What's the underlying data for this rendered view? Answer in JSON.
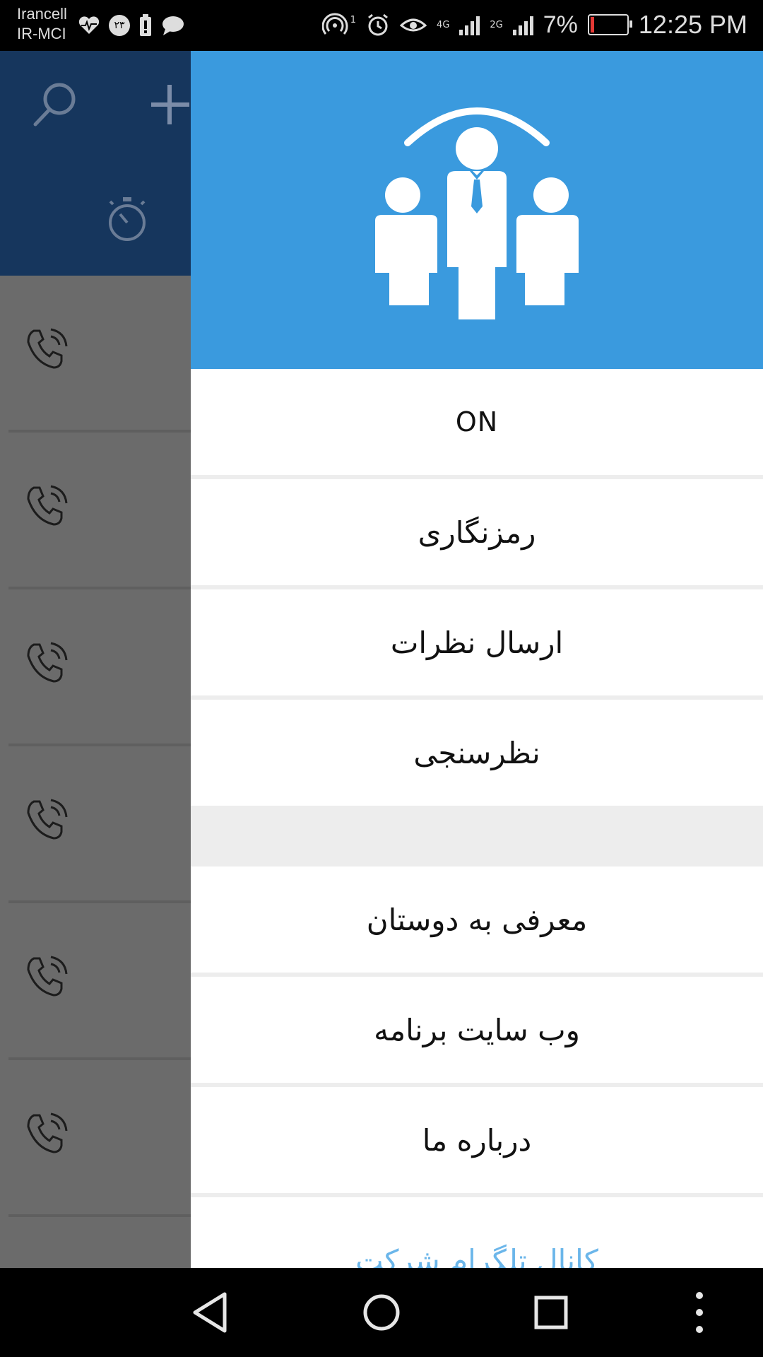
{
  "status_bar": {
    "carrier_1": "Irancell",
    "carrier_2": "IR-MCI",
    "notif_badge": "۲۳",
    "network_1": "4G",
    "network_2": "2G",
    "sim_index": "1",
    "battery": "7%",
    "time": "12:25 PM"
  },
  "drawer": {
    "items": [
      {
        "label": "ON"
      },
      {
        "label": "رمزنگاری"
      },
      {
        "label": "ارسال نظرات"
      },
      {
        "label": "نظرسنجی"
      },
      {
        "label": "معرفی به دوستان"
      },
      {
        "label": "وب سایت برنامه"
      },
      {
        "label": "درباره ما"
      },
      {
        "label": "کانال تلگرام شرکت"
      }
    ]
  },
  "colors": {
    "drawer_header": "#3a9ade",
    "app_header": "#16365d",
    "link_text": "#6bb6ea"
  },
  "icons": [
    "search-icon",
    "plus-icon",
    "stopwatch-icon",
    "phone-call-icon",
    "team-logo-icon",
    "back-icon",
    "home-icon",
    "recents-icon",
    "menu-dots-icon"
  ]
}
